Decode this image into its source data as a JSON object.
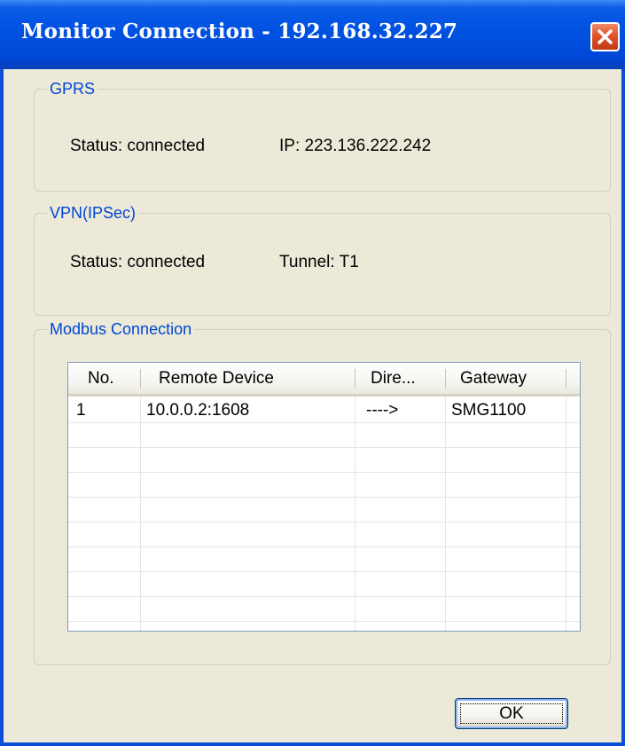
{
  "window": {
    "title": "Monitor Connection - 192.168.32.227"
  },
  "gprs": {
    "legend": "GPRS",
    "status": "Status: connected",
    "ip": "IP: 223.136.222.242"
  },
  "vpn": {
    "legend": "VPN(IPSec)",
    "status": "Status: connected",
    "tunnel": "Tunnel: T1"
  },
  "modbus": {
    "legend": "Modbus Connection",
    "columns": [
      "No.",
      "Remote Device",
      "Dire...",
      "Gateway"
    ],
    "rows": [
      {
        "no": "1",
        "remote_device": "10.0.0.2:1608",
        "direction": "---->",
        "gateway": "SMG1100"
      }
    ]
  },
  "buttons": {
    "ok": "OK"
  },
  "colors": {
    "titlebar": "#0050df",
    "dialog_bg": "#ece9d8",
    "legend_text": "#0046d5",
    "close_button": "#e0542c"
  }
}
